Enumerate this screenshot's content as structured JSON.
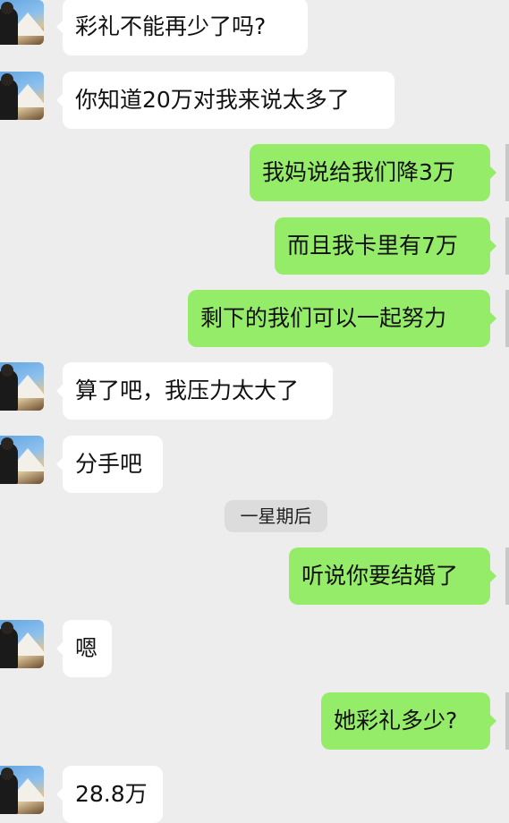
{
  "divider": {
    "label": "一星期后"
  },
  "messages": [
    {
      "side": "in",
      "text": "彩礼不能再少了吗?"
    },
    {
      "side": "in",
      "text": "你知道20万对我来说太多了"
    },
    {
      "side": "out",
      "text": "我妈说给我们降3万"
    },
    {
      "side": "out",
      "text": "而且我卡里有7万"
    },
    {
      "side": "out",
      "text": "剩下的我们可以一起努力"
    },
    {
      "side": "in",
      "text": "算了吧，我压力太大了"
    },
    {
      "side": "in",
      "text": "分手吧"
    },
    {
      "side": "out",
      "text": "听说你要结婚了"
    },
    {
      "side": "in",
      "text": "嗯"
    },
    {
      "side": "out",
      "text": "她彩礼多少?"
    },
    {
      "side": "in",
      "text": "28.8万"
    }
  ],
  "colors": {
    "background": "#ededed",
    "incoming_bubble": "#ffffff",
    "outgoing_bubble": "#95ec69"
  }
}
